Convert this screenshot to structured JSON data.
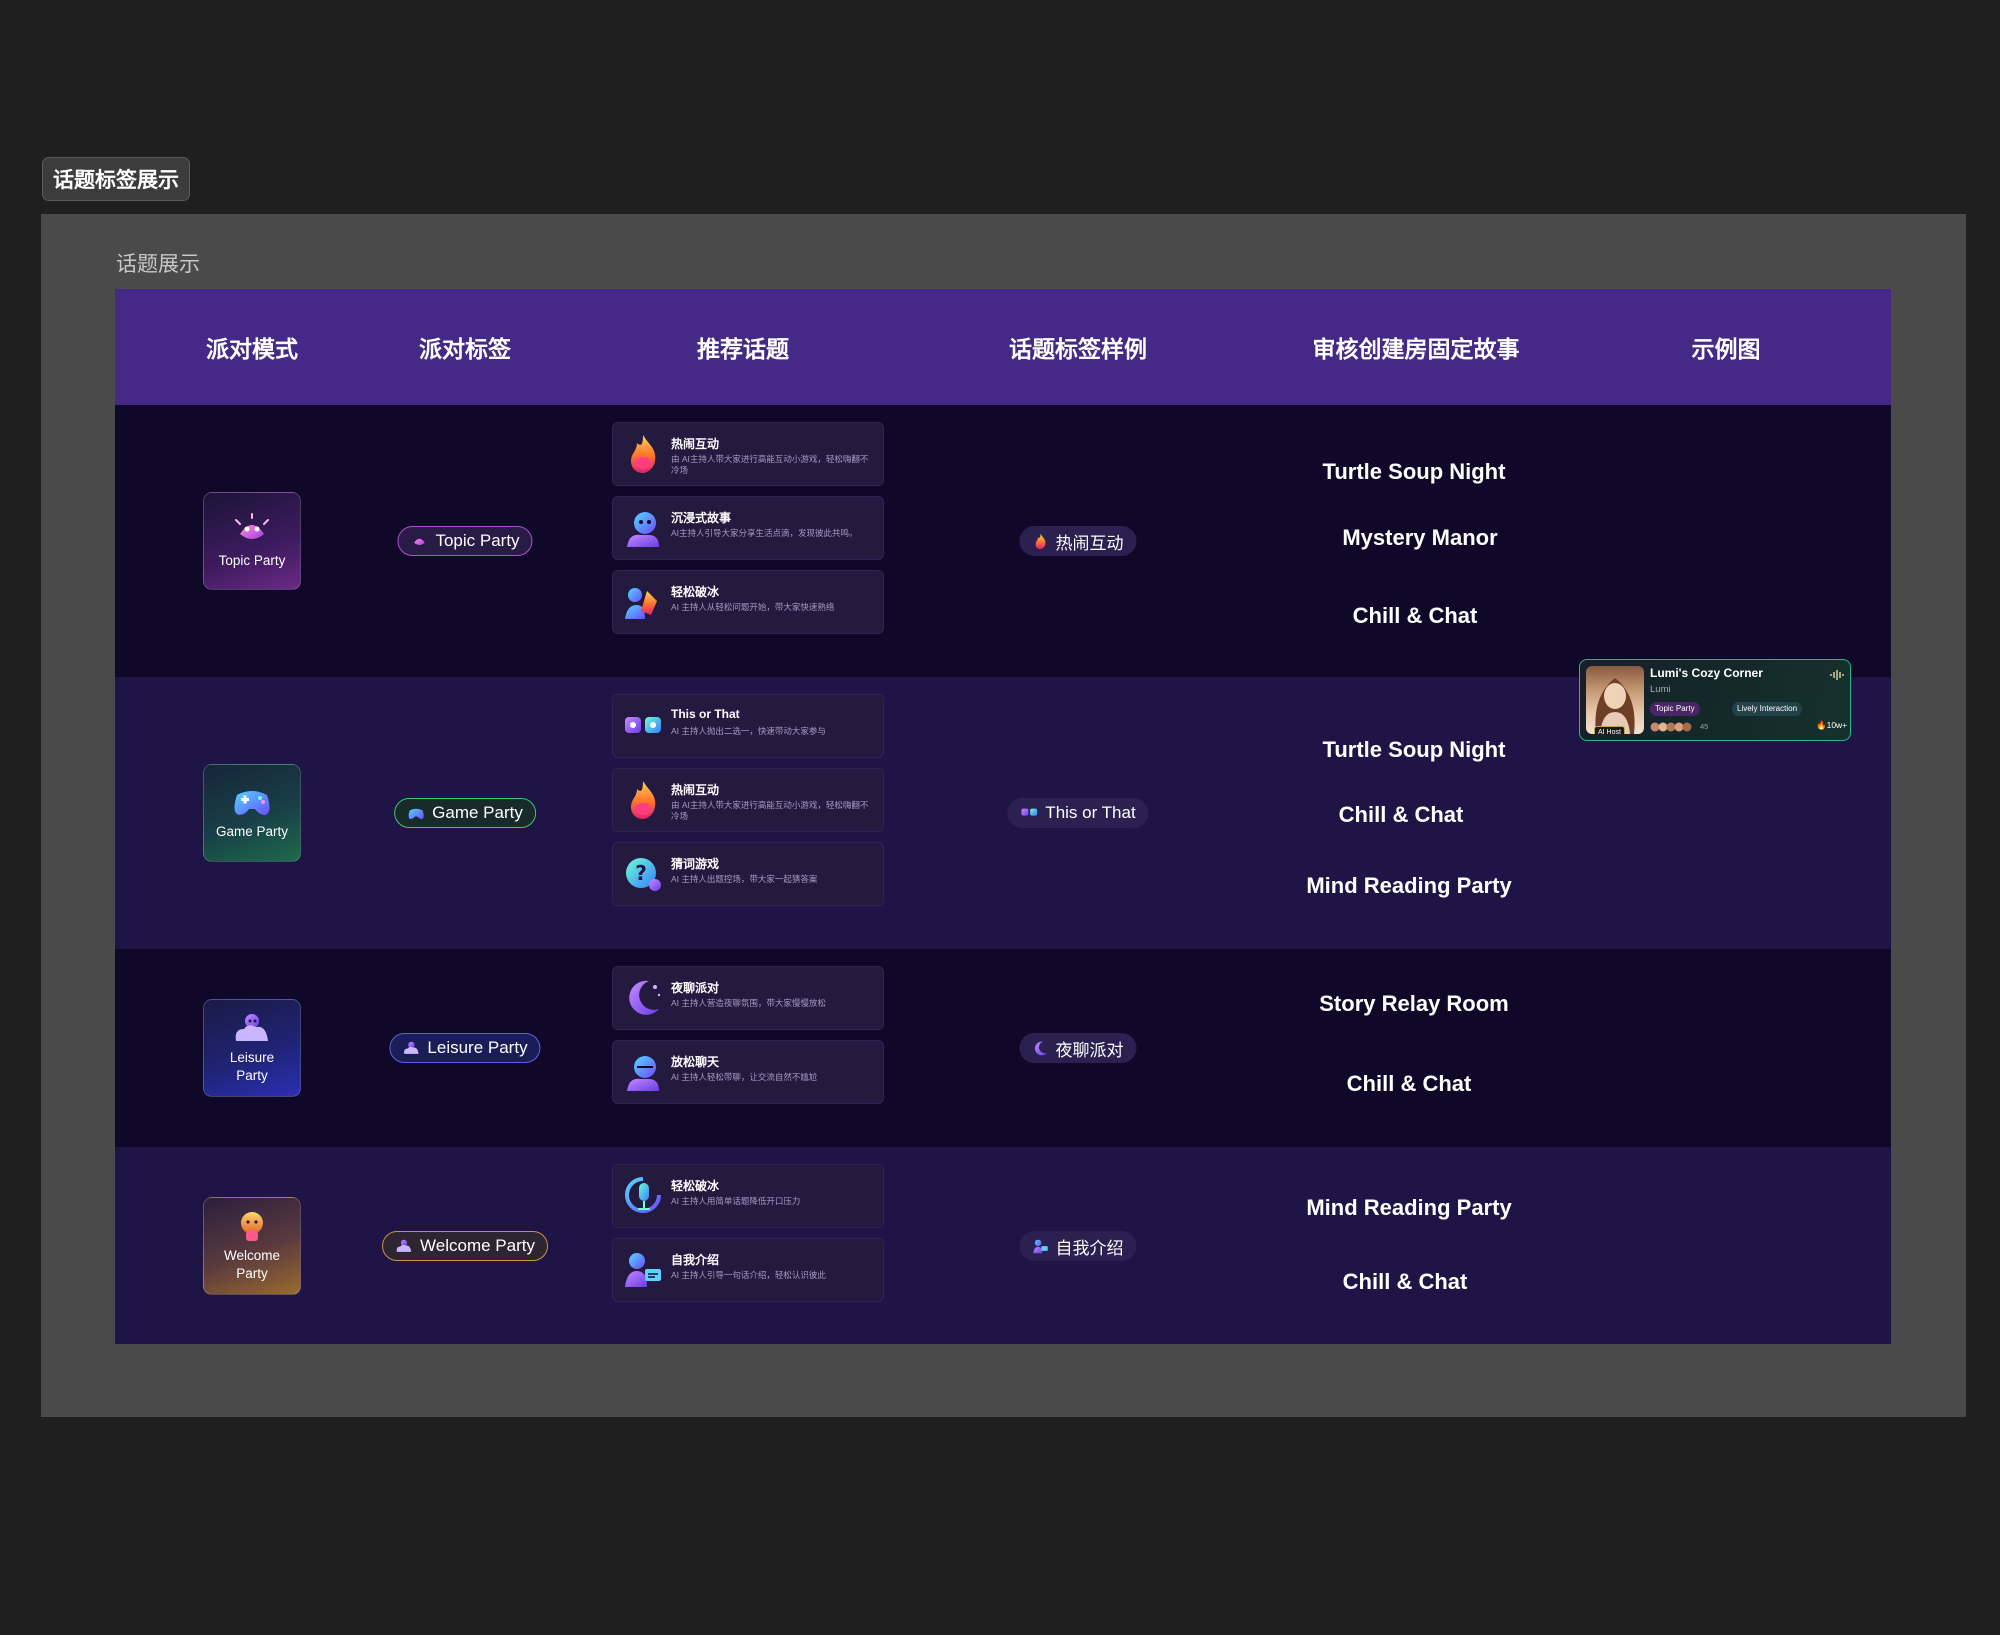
{
  "frame": {
    "tag": "话题标签展示",
    "section_label": "话题展示"
  },
  "columns": [
    "派对模式",
    "派对标签",
    "推荐话题",
    "话题标签样例",
    "审核创建房固定故事",
    "示例图"
  ],
  "rows": [
    {
      "mode": "Topic Party",
      "tag": "Topic Party",
      "topics": [
        {
          "title": "热闹互动",
          "desc": "由 AI主持人带大家进行高能互动小游戏，轻松嗨翻不冷场",
          "icon": "fire-icon"
        },
        {
          "title": "沉浸式故事",
          "desc": "AI主持人引导大家分享生活点滴，发现彼此共鸣。",
          "icon": "storyteller-icon"
        },
        {
          "title": "轻松破冰",
          "desc": "AI 主持人从轻松问题开始，带大家快速熟络",
          "icon": "icebreaker-icon"
        }
      ],
      "sample": "热闹互动",
      "stories": [
        "Turtle Soup Night",
        "Mystery Manor",
        "Chill & Chat"
      ]
    },
    {
      "mode": "Game Party",
      "tag": "Game Party",
      "topics": [
        {
          "title": "This or That",
          "desc": "AI 主持人抛出二选一，快速带动大家参与",
          "icon": "versus-icon"
        },
        {
          "title": "热闹互动",
          "desc": "由 AI主持人带大家进行高能互动小游戏，轻松嗨翻不冷场",
          "icon": "fire-icon"
        },
        {
          "title": "猜词游戏",
          "desc": "AI 主持人出题控场，带大家一起猜答案",
          "icon": "guess-icon"
        }
      ],
      "sample": "This or That",
      "stories": [
        "Turtle Soup Night",
        "Chill & Chat",
        "Mind Reading Party"
      ],
      "example": {
        "title": "Lumi's Cozy Corner",
        "host": "Lumi",
        "badge": "AI Host",
        "tag1": "Topic Party",
        "tag2": "Lively Interaction",
        "count": "45",
        "hot": "10w+"
      }
    },
    {
      "mode": "Leisure Party",
      "tag": "Leisure Party",
      "topics": [
        {
          "title": "夜聊派对",
          "desc": "AI 主持人营造夜聊氛围，带大家慢慢放松",
          "icon": "moon-icon"
        },
        {
          "title": "放松聊天",
          "desc": "AI 主持人轻松带聊，让交流自然不尴尬",
          "icon": "chat-icon"
        }
      ],
      "sample": "夜聊派对",
      "stories": [
        "Story Relay Room",
        "Chill & Chat"
      ]
    },
    {
      "mode": "Welcome Party",
      "tag": "Welcome Party",
      "topics": [
        {
          "title": "轻松破冰",
          "desc": "AI 主持人用简单话题降低开口压力",
          "icon": "microphone-icon"
        },
        {
          "title": "自我介绍",
          "desc": "AI 主持人引导一句话介绍，轻松认识彼此",
          "icon": "profile-card-icon"
        }
      ],
      "sample": "自我介绍",
      "stories": [
        "Mind Reading Party",
        "Chill & Chat"
      ]
    }
  ],
  "colors": {
    "header": "#442a86",
    "row_dark": "#0f0829",
    "row_light": "#1e1446",
    "topic_accent": "#b24bd8",
    "game_accent": "#3fc56a",
    "leisure_accent": "#5b5fe8",
    "welcome_accent": "#c8953b"
  }
}
